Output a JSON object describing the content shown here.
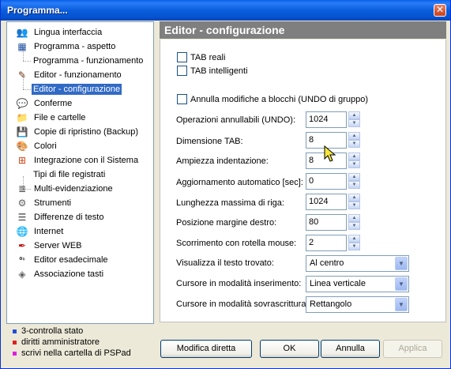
{
  "window": {
    "title": "Programma...",
    "close_glyph": "✕"
  },
  "tree": {
    "items": [
      {
        "label": "Lingua interfaccia",
        "icon": "people-icon",
        "glyph": "👥"
      },
      {
        "label": "Programma - aspetto",
        "icon": "window-layout-icon",
        "glyph": "▦"
      },
      {
        "label": "Programma - funzionamento",
        "icon": "",
        "glyph": ""
      },
      {
        "label": "Editor - funzionamento",
        "icon": "pencil-icon",
        "glyph": "✎"
      },
      {
        "label": "Editor - configurazione",
        "icon": "",
        "glyph": ""
      },
      {
        "label": "Conferme",
        "icon": "speech-bubble-icon",
        "glyph": "💬"
      },
      {
        "label": "File e cartelle",
        "icon": "folder-icon",
        "glyph": "📁"
      },
      {
        "label": "Copie di ripristino (Backup)",
        "icon": "floppy-disk-icon",
        "glyph": "💾"
      },
      {
        "label": "Colori",
        "icon": "palette-icon",
        "glyph": "🎨"
      },
      {
        "label": "Integrazione con il Sistema",
        "icon": "windows-logo-icon",
        "glyph": "⊞"
      },
      {
        "label": "Tipi di file registrati",
        "icon": "",
        "glyph": ""
      },
      {
        "label": "Multi-evidenziazione",
        "icon": "list-lines-icon",
        "glyph": "≣"
      },
      {
        "label": "Strumenti",
        "icon": "gear-icon",
        "glyph": "⚙"
      },
      {
        "label": "Differenze di testo",
        "icon": "document-compare-icon",
        "glyph": "☰"
      },
      {
        "label": "Internet",
        "icon": "globe-icon",
        "glyph": "🌐"
      },
      {
        "label": "Server WEB",
        "icon": "feather-icon",
        "glyph": "✒"
      },
      {
        "label": "Editor esadecimale",
        "icon": "binary-icon",
        "glyph": "⁰¹"
      },
      {
        "label": "Associazione tasti",
        "icon": "key-diamond-icon",
        "glyph": "◈"
      }
    ]
  },
  "legend": [
    {
      "label": "3-controlla stato",
      "color": "#1f4fd8"
    },
    {
      "label": "diritti amministratore",
      "color": "#e02020"
    },
    {
      "label": "scrivi nella cartella di PSPad",
      "color": "#e020e0"
    }
  ],
  "panel": {
    "title": "Editor - configurazione",
    "checkboxes": {
      "tab_reali": "TAB reali",
      "tab_intelligenti": "TAB intelligenti",
      "annulla_blocchi": "Annulla modifiche a blocchi (UNDO di gruppo)"
    },
    "fields": [
      {
        "label": "Operazioni annullabili (UNDO):",
        "value": "1024"
      },
      {
        "label": "Dimensione TAB:",
        "value": "8"
      },
      {
        "label": "Ampiezza indentazione:",
        "value": "8"
      },
      {
        "label": "Aggiornamento automatico [sec]:",
        "value": "0"
      },
      {
        "label": "Lunghezza massima di riga:",
        "value": "1024"
      },
      {
        "label": "Posizione margine destro:",
        "value": "80"
      },
      {
        "label": "Scorrimento con rotella mouse:",
        "value": "2"
      }
    ],
    "combos": [
      {
        "label": "Visualizza il testo trovato:",
        "value": "Al centro"
      },
      {
        "label": "Cursore in modalità inserimento:",
        "value": "Linea verticale"
      },
      {
        "label": "Cursore in modalità sovrascrittura:",
        "value": "Rettangolo"
      }
    ]
  },
  "buttons": {
    "modifica": "Modifica diretta",
    "ok": "OK",
    "annulla": "Annulla",
    "applica": "Applica"
  },
  "glyphs": {
    "up": "▲",
    "down": "▼",
    "dropdown": "▼"
  }
}
